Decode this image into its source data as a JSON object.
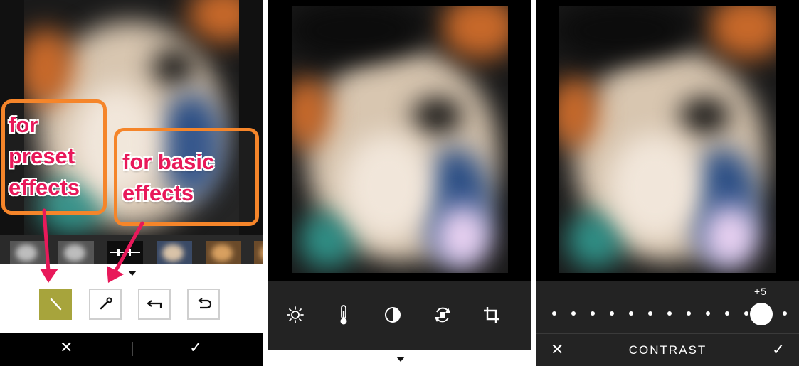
{
  "annotations": {
    "preset_label_line1": "for",
    "preset_label_line2": "preset",
    "preset_label_line3": "effects",
    "basic_label_line1": "for basic",
    "basic_label_line2": "effects",
    "arrow_color": "#e8195a",
    "box_color": "#f5852a"
  },
  "panel1": {
    "filmstrip_thumbnails": [
      "grayscale-filter",
      "grayscale-filter",
      "adjust-filter",
      "warm-filter",
      "warm-filter",
      "warm-filter"
    ],
    "tools": [
      {
        "icon": "pencil-icon",
        "active": true
      },
      {
        "icon": "wrench-icon",
        "active": false
      },
      {
        "icon": "undo-icon",
        "active": false
      },
      {
        "icon": "reset-icon",
        "active": false
      }
    ],
    "cancel_glyph": "✕",
    "confirm_glyph": "✓",
    "active_color": "#a7a43c"
  },
  "panel2": {
    "tools": [
      "brightness-icon",
      "temperature-icon",
      "contrast-icon",
      "rotate-icon",
      "crop-icon"
    ],
    "toolbar_color": "#232323"
  },
  "panel3": {
    "slider_value": "+5",
    "slider_level": 5,
    "title": "CONTRAST",
    "cancel_glyph": "✕",
    "confirm_glyph": "✓"
  }
}
